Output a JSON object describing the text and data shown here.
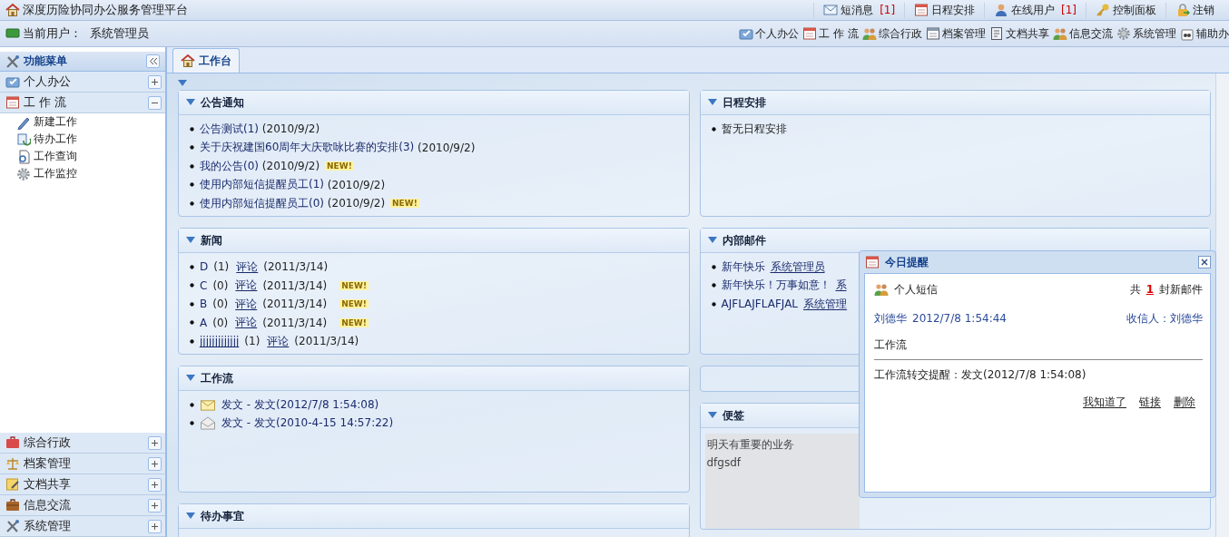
{
  "app_title": "深度历险协同办公服务管理平台",
  "top_links": [
    {
      "label": "短消息",
      "count": "[1]"
    },
    {
      "label": "日程安排"
    },
    {
      "label": "在线用户",
      "count": "[1]"
    },
    {
      "label": "控制面板"
    },
    {
      "label": "注销"
    }
  ],
  "current_user": {
    "label": "当前用户：",
    "name": "系统管理员"
  },
  "modules": [
    "个人办公",
    "工 作 流",
    "综合行政",
    "档案管理",
    "文档共享",
    "信息交流",
    "系统管理",
    "辅助办"
  ],
  "sidebar": {
    "title": "功能菜单",
    "groups": [
      {
        "label": "个人办公",
        "expanded": false
      },
      {
        "label": "工 作 流",
        "expanded": true,
        "children": [
          "新建工作",
          "待办工作",
          "工作查询",
          "工作监控"
        ]
      }
    ],
    "bottom_groups": [
      {
        "label": "综合行政",
        "expanded": false
      },
      {
        "label": "档案管理",
        "expanded": false
      },
      {
        "label": "文档共享",
        "expanded": false
      },
      {
        "label": "信息交流",
        "expanded": false
      },
      {
        "label": "系统管理",
        "expanded": false
      }
    ]
  },
  "tabs": [
    {
      "label": "工作台",
      "selected": true
    }
  ],
  "panels": {
    "notices": {
      "title": "公告通知",
      "items": [
        {
          "title": "公告测试(1)",
          "date": "(2010/9/2)"
        },
        {
          "title": "关于庆祝建国60周年大庆歌咏比赛的安排(3)",
          "date": "(2010/9/2)"
        },
        {
          "title": "我的公告(0)",
          "date": "(2010/9/2)",
          "badge": "NEW!"
        },
        {
          "title": "使用内部短信提醒员工(1)",
          "date": "(2010/9/2)"
        },
        {
          "title": "使用内部短信提醒员工(0)",
          "date": "(2010/9/2)",
          "badge": "NEW!"
        }
      ]
    },
    "news": {
      "title": "新闻",
      "items": [
        {
          "title": "D",
          "count": "(1)",
          "link": "评论",
          "date": "(2011/3/14)",
          "underlined": false
        },
        {
          "title": "C",
          "count": "(0)",
          "link": "评论",
          "date": "(2011/3/14)",
          "badge": "NEW!",
          "underlined": false
        },
        {
          "title": "B",
          "count": "(0)",
          "link": "评论",
          "date": "(2011/3/14)",
          "badge": "NEW!",
          "underlined": false
        },
        {
          "title": "A",
          "count": "(0)",
          "link": "评论",
          "date": "(2011/3/14)",
          "badge": "NEW!",
          "underlined": false
        },
        {
          "title": "jjjjjjjjjjjjj",
          "count": "(1)",
          "link": "评论",
          "date": "(2011/3/14)",
          "underlined": true
        }
      ]
    },
    "workflow": {
      "title": "工作流",
      "items": [
        {
          "text": "发文 - 发文(2012/7/8 1:54:08)",
          "read": false
        },
        {
          "text": "发文 - 发文(2010-4-15 14:57:22)",
          "read": true
        }
      ]
    },
    "todo": {
      "title": "待办事宜"
    },
    "schedule": {
      "title": "日程安排",
      "items": [
        "暂无日程安排"
      ]
    },
    "mail": {
      "title": "内部邮件",
      "items": [
        {
          "subject": "新年快乐",
          "sender": "系统管理员"
        },
        {
          "subject": "新年快乐！万事如意！",
          "sender": "系"
        },
        {
          "subject": "AJFLAJFLAFJAL",
          "sender": "系统管理"
        }
      ]
    },
    "notes": {
      "title": "便签",
      "lines": [
        "明天有重要的业务",
        "dfgsdf"
      ]
    }
  },
  "reminder": {
    "title": "今日提醒",
    "section": "个人短信",
    "total_prefix": "共",
    "total": "1",
    "total_suffix": "封新邮件",
    "sender": "刘德华",
    "time": "2012/7/8 1:54:44",
    "recipient": "收信人：刘德华",
    "subject": "工作流",
    "body": "工作流转交提醒：发文(2012/7/8 1:54:08)",
    "actions": [
      "我知道了",
      "链接",
      "删除"
    ]
  }
}
